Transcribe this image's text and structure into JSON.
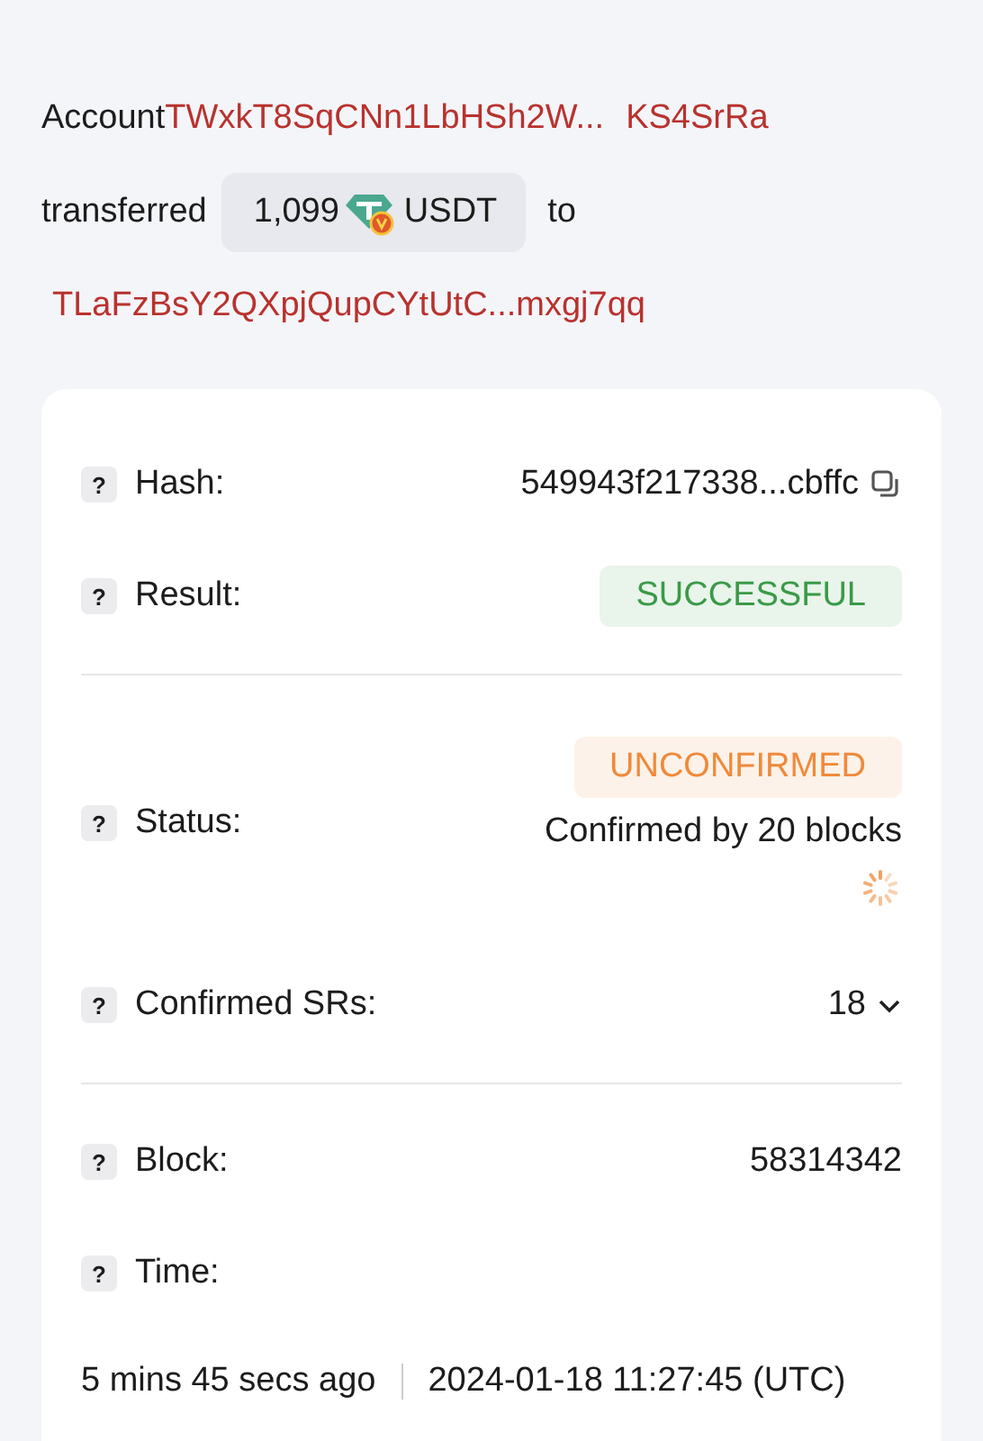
{
  "summary": {
    "account_label": "Account",
    "from_address": "TWxkT8SqCNn1LbHSh2W...",
    "from_address_tail": "KS4SrRa",
    "verb": "transferred",
    "amount": "1,099",
    "token": "USDT",
    "to_word": "to",
    "to_address": "TLaFzBsY2QXpjQupCYtUtC...mxgj7qq"
  },
  "details": [
    {
      "kind": "hash",
      "help": "?",
      "label": "Hash:",
      "value": "549943f217338...cbffc"
    },
    {
      "kind": "badge",
      "help": "?",
      "label": "Result:",
      "badge": "SUCCESSFUL",
      "color": "#3a9a47"
    },
    {
      "kind": "divider"
    },
    {
      "kind": "status",
      "help": "?",
      "label": "Status:",
      "badge": "UNCONFIRMED",
      "color": "#ef8a3a",
      "note": "Confirmed by 20 blocks"
    },
    {
      "kind": "dropdown",
      "help": "?",
      "label": "Confirmed SRs:",
      "value": "18",
      "expanded": false
    },
    {
      "kind": "divider"
    },
    {
      "kind": "plain",
      "help": "?",
      "label": "Block:",
      "value": "58314342"
    },
    {
      "kind": "time",
      "help": "?",
      "label": "Time:",
      "ago": "5 mins 45 secs ago",
      "timestamp": "2024-01-18 11:27:45 (UTC)"
    }
  ]
}
